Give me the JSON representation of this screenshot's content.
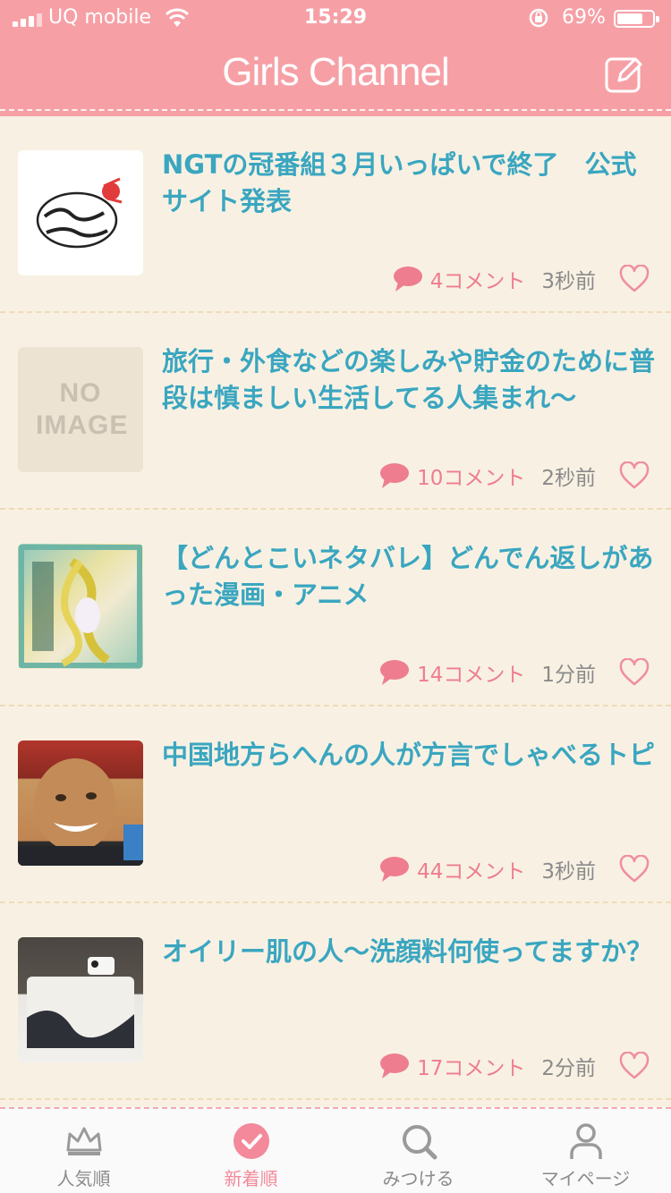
{
  "status_bar": {
    "carrier": "UQ mobile",
    "time": "15:29",
    "battery": "69%"
  },
  "header": {
    "title": "Girls Channel"
  },
  "topics": [
    {
      "title": "NGTの冠番組３月いっぱいで終了　公式サイト発表",
      "comments": "4コメント",
      "ago": "3秒前",
      "thumb_text": ""
    },
    {
      "title": "旅行・外食などの楽しみや貯金のために普段は慎ましい生活してる人集まれ〜",
      "comments": "10コメント",
      "ago": "2秒前",
      "thumb_text": "NO IMAGE"
    },
    {
      "title": "【どんとこいネタバレ】どんでん返しがあった漫画・アニメ",
      "comments": "14コメント",
      "ago": "1分前",
      "thumb_text": ""
    },
    {
      "title": "中国地方らへんの人が方言でしゃべるトピ",
      "comments": "44コメント",
      "ago": "3秒前",
      "thumb_text": ""
    },
    {
      "title": "オイリー肌の人〜洗顔料何使ってますか？",
      "comments": "17コメント",
      "ago": "2分前",
      "thumb_text": ""
    }
  ],
  "tabs": [
    {
      "label": "人気順"
    },
    {
      "label": "新着順"
    },
    {
      "label": "みつける"
    },
    {
      "label": "マイページ"
    }
  ],
  "colors": {
    "header": "#f6a0a6",
    "title_text": "#3aa6c0",
    "accent": "#ee7d8f",
    "background": "#f8f1e3"
  }
}
